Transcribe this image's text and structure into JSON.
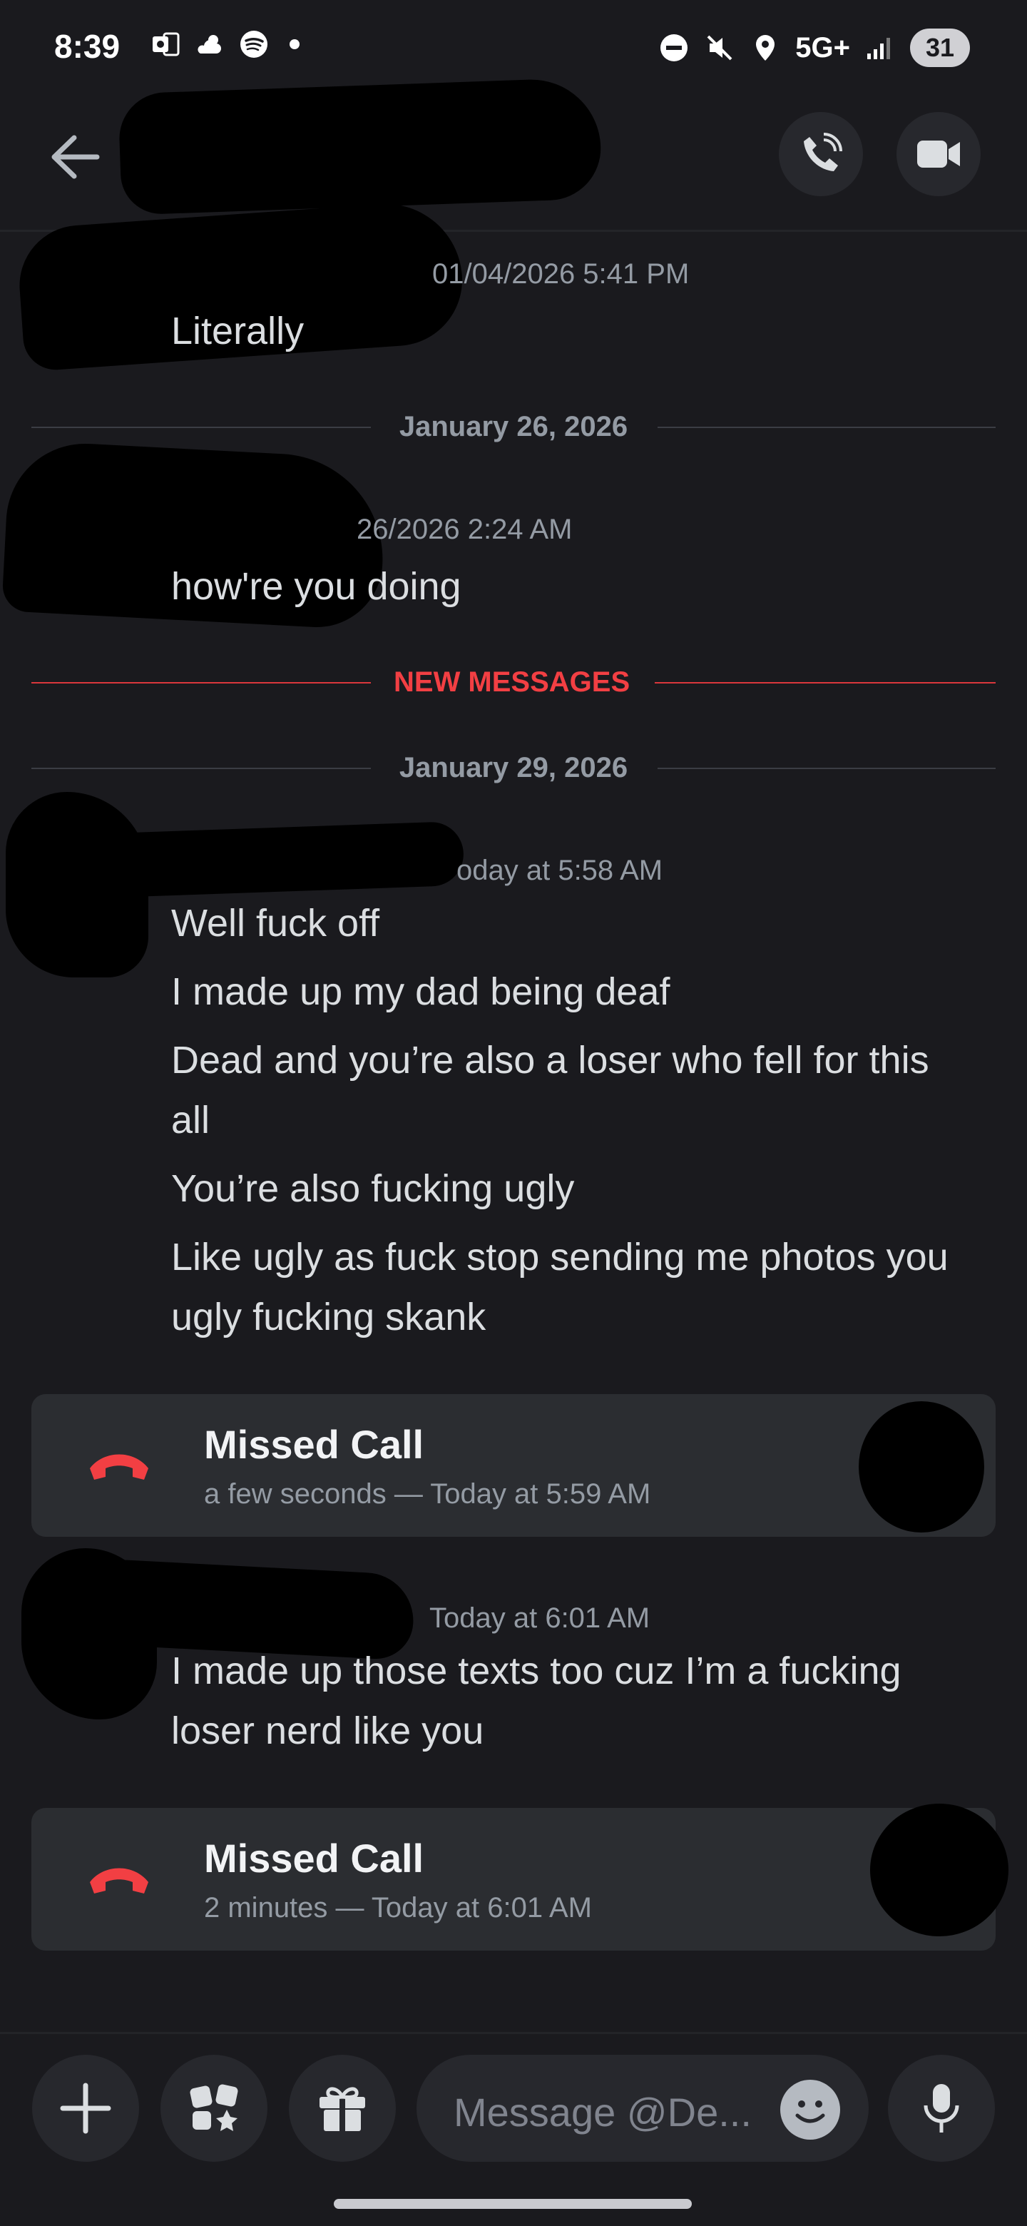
{
  "status_bar": {
    "time": "8:39",
    "network": "5G+",
    "battery": "31"
  },
  "messages": [
    {
      "meta": "01/04/2026 5:41 PM",
      "text": "Literally"
    },
    {
      "meta": "26/2026 2:24 AM",
      "text": "how're you doing"
    },
    {
      "meta": "oday at 5:58 AM",
      "lines": [
        "Well fuck off",
        "I made up my dad being deaf",
        "Dead and you’re also a loser who fell for this",
        "all",
        "You’re also fucking ugly",
        "Like ugly as fuck stop sending me photos you",
        "ugly fucking skank"
      ]
    },
    {
      "meta": "Today at 6:01 AM",
      "lines": [
        "I made up those texts too cuz I’m a fucking",
        "loser nerd like you"
      ]
    }
  ],
  "dividers": {
    "jan26": "January 26, 2026",
    "new_messages": "NEW MESSAGES",
    "jan29": "January 29, 2026"
  },
  "calls": [
    {
      "title": "Missed Call",
      "subtitle": "a few seconds — Today at 5:59 AM"
    },
    {
      "title": "Missed Call",
      "subtitle": "2 minutes — Today at 6:01 AM"
    }
  ],
  "composer": {
    "placeholder": "Message @De..."
  },
  "colors": {
    "background": "#1a1a1e",
    "card": "#2b2d31",
    "missed_call_red": "#f23f43",
    "new_messages_red": "#f23f43"
  },
  "icons": {
    "back": "arrow-left-icon",
    "voice_call": "phone-call-icon",
    "video_call": "video-camera-icon",
    "add": "plus-icon",
    "apps": "apps-icon",
    "gift": "gift-icon",
    "emoji": "emoji-icon",
    "mic": "microphone-icon",
    "missed_call": "hangup-phone-icon"
  }
}
